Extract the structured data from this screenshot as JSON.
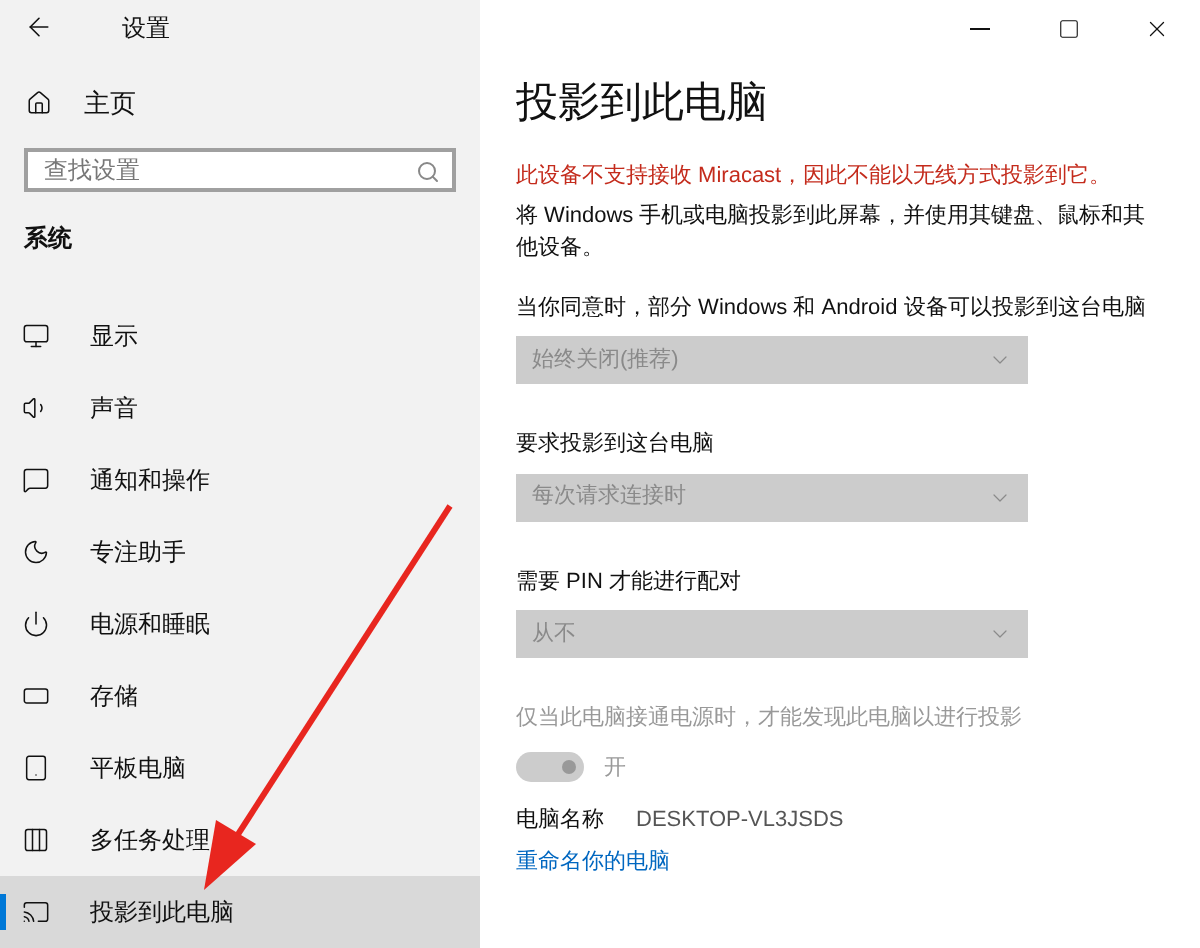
{
  "window": {
    "title": "设置"
  },
  "sidebar": {
    "home": "主页",
    "search": {
      "placeholder": "查找设置"
    },
    "section": "系统",
    "items": [
      {
        "label": "显示",
        "selected": false
      },
      {
        "label": "声音",
        "selected": false
      },
      {
        "label": "通知和操作",
        "selected": false
      },
      {
        "label": "专注助手",
        "selected": false
      },
      {
        "label": "电源和睡眠",
        "selected": false
      },
      {
        "label": "存储",
        "selected": false
      },
      {
        "label": "平板电脑",
        "selected": false
      },
      {
        "label": "多任务处理",
        "selected": false
      },
      {
        "label": "投影到此电脑",
        "selected": true
      }
    ]
  },
  "page": {
    "title": "投影到此电脑",
    "warning": "此设备不支持接收 Miracast，因此不能以无线方式投影到它。",
    "description": "将 Windows 手机或电脑投影到此屏幕，并使用其键盘、鼠标和其他设备。",
    "dropdowns": [
      {
        "label": "当你同意时，部分 Windows 和 Android 设备可以投影到这台电脑",
        "value": "始终关闭(推荐)",
        "disabled": true
      },
      {
        "label": "要求投影到这台电脑",
        "value": "每次请求连接时",
        "disabled": true
      },
      {
        "label": "需要 PIN 才能进行配对",
        "value": "从不",
        "disabled": true
      }
    ],
    "power_toggle": {
      "label": "仅当此电脑接通电源时，才能发现此电脑以进行投影",
      "state": "开",
      "on": true,
      "disabled": true
    },
    "pc_name": {
      "label": "电脑名称",
      "value": "DESKTOP-VL3JSDS"
    },
    "rename_link": "重命名你的电脑"
  }
}
